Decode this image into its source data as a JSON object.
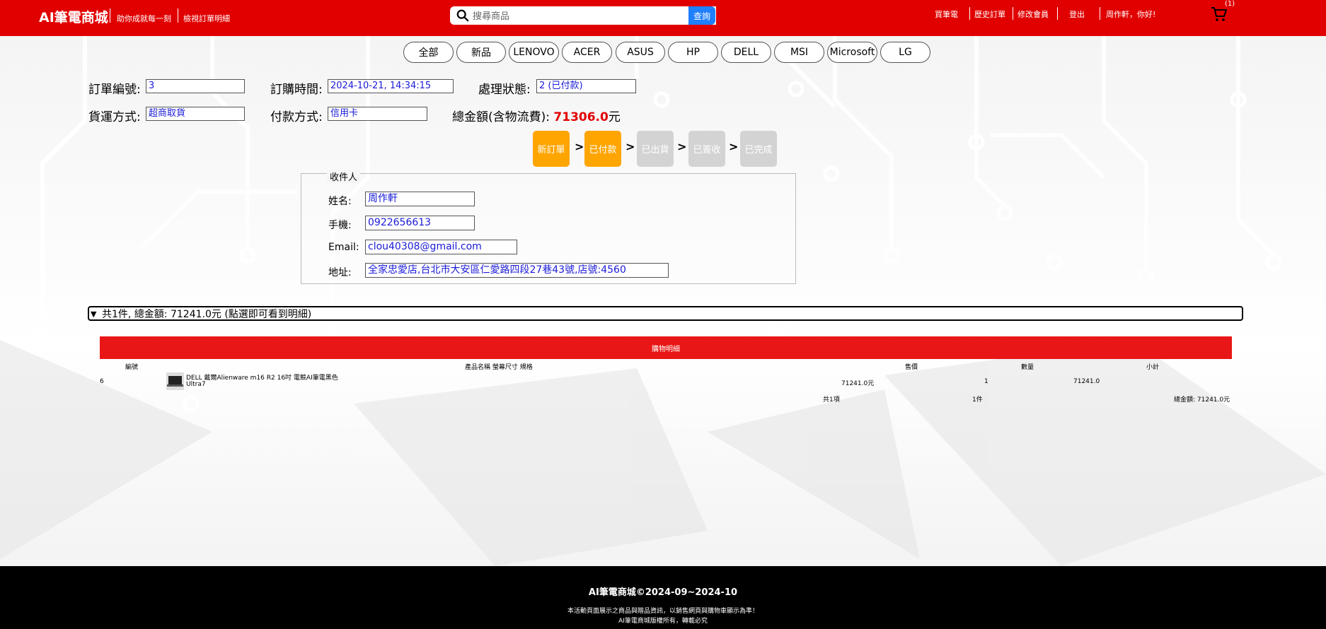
{
  "header": {
    "brand": "AI筆電商城",
    "tagline": "助你成就每一刻",
    "view_order_link": "檢視訂單明細",
    "search_placeholder": "搜尋商品",
    "search_button": "查詢",
    "nav": {
      "buy": "買筆電",
      "history": "歷史訂單",
      "edit_member": "修改會員",
      "logout": "登出",
      "greeting": "周作軒，你好!"
    },
    "cart_count": "(1)"
  },
  "categories": [
    "全部",
    "新品",
    "LENOVO",
    "ACER",
    "ASUS",
    "HP",
    "DELL",
    "MSI",
    "Microsoft",
    "LG"
  ],
  "order": {
    "id_label": "訂單編號:",
    "id_value": "3",
    "time_label": "訂購時間:",
    "time_value": "2024-10-21, 14:34:15",
    "status_label": "處理狀態:",
    "status_value": "2 (已付款)",
    "shipping_label": "貨運方式:",
    "shipping_value": "超商取貨",
    "payment_label": "付款方式:",
    "payment_value": "信用卡",
    "total_label": "總金額(含物流費):",
    "total_value": "71306.0",
    "total_unit": "元"
  },
  "steps": [
    {
      "label": "新訂單",
      "active": true
    },
    {
      "label": "已付款",
      "active": true
    },
    {
      "label": "已出貨",
      "active": false
    },
    {
      "label": "已簽收",
      "active": false
    },
    {
      "label": "已完成",
      "active": false
    }
  ],
  "recipient": {
    "legend": "收件人",
    "name_label": "姓名:",
    "name_value": "周作軒",
    "phone_label": "手機:",
    "phone_value": "0922656613",
    "email_label": "Email:",
    "email_value": "clou40308@gmail.com",
    "address_label": "地址:",
    "address_value": "全家忠愛店,台北市大安區仁愛路四段27巷43號,店號:4560"
  },
  "summary": "共1件, 總金額: 71241.0元 (點選即可看到明細)",
  "details": {
    "title": "購物明細",
    "headers": [
      "編號",
      "產品名稱 螢幕尺寸 規格",
      "售價",
      "數量",
      "小計"
    ],
    "item": {
      "id": "6",
      "name_line1": "DELL 戴爾Alienware m16 R2 16吋 電競AI筆電黑色",
      "name_line2": "Ultra7",
      "price": "71241.0元",
      "qty": "1",
      "subtotal": "71241.0"
    },
    "footer": {
      "items": "共1項",
      "qty": "1件",
      "total": "總金額: 71241.0元"
    }
  },
  "footer": {
    "title": "AI筆電商城©2024-09~2024-10",
    "line1": "本活動頁面展示之商品與贈品資訊，以銷售網頁與購物車顯示為準！",
    "line2": "AI筆電商城版權所有，轉載必究"
  }
}
